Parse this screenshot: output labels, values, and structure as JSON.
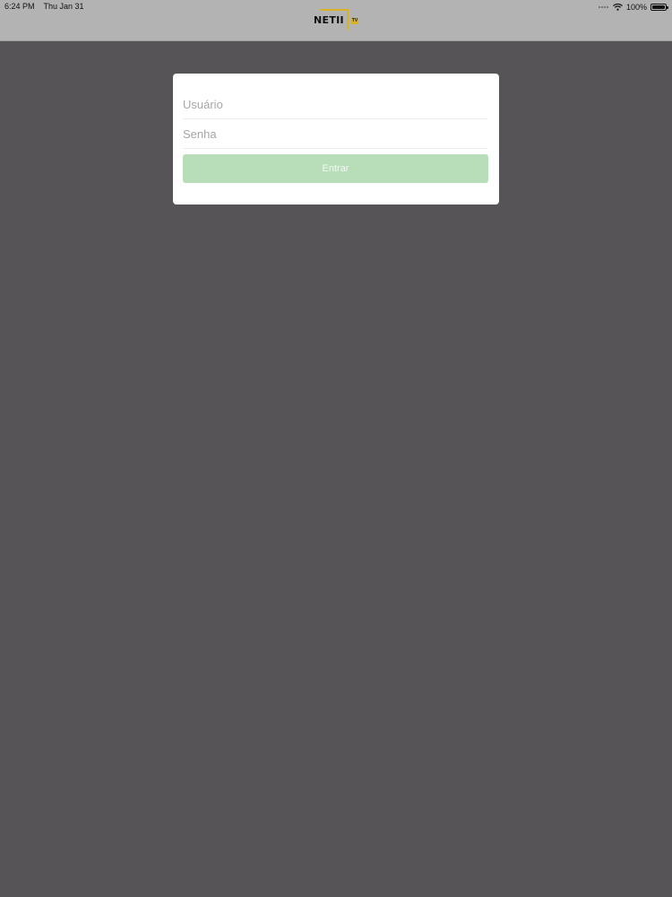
{
  "status_bar": {
    "time": "6:24 PM",
    "date": "Thu Jan 31",
    "battery": "100%",
    "wifi_icon": "wifi-icon",
    "battery_icon": "battery-icon"
  },
  "header": {
    "logo_text": "NET",
    "logo_suffix": "II",
    "logo_badge": "TV",
    "logo_color": "#d8b326"
  },
  "login_form": {
    "username_placeholder": "Usuário",
    "username_value": "",
    "password_placeholder": "Senha",
    "password_value": "",
    "submit_label": "Entrar",
    "submit_color": "#b7deb9"
  },
  "colors": {
    "background": "#565456",
    "topbar": "#b3b3b3",
    "card": "#ffffff"
  }
}
